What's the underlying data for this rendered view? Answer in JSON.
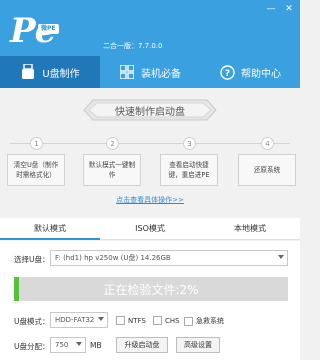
{
  "window": {
    "logo_text": "Pe",
    "logo_badge": "微PE",
    "version": "二合一版：7.7.0.0",
    "minimize_glyph": "—",
    "close_glyph": "✕"
  },
  "nav_tabs": [
    {
      "label": "U盘制作",
      "icon": "usb-drive-icon",
      "active": true
    },
    {
      "label": "装机必备",
      "icon": "apps-grid-icon",
      "active": false
    },
    {
      "label": "帮助中心",
      "icon": "help-circle-icon",
      "active": false
    }
  ],
  "banner": {
    "title": "快速制作启动盘"
  },
  "steps": [
    {
      "num": "1",
      "text": "清空U盘（制作时需格式化）"
    },
    {
      "num": "2",
      "text": "默认模式一键制作"
    },
    {
      "num": "3",
      "text": "查看启动快捷键，重启进PE"
    },
    {
      "num": "4",
      "text": "还原系统"
    }
  ],
  "steps_link": "点击查看具体操作>>",
  "mode_tabs": [
    {
      "label": "默认模式",
      "active": true
    },
    {
      "label": "ISO模式",
      "active": false
    },
    {
      "label": "本地模式",
      "active": false
    }
  ],
  "form": {
    "select_usb_label": "选择U盘：",
    "select_usb_value": "F: (hd1) hp v250w  (U盘) 14.26GB",
    "progress_text": "正在检验文件:2%",
    "progress_value": 0.02,
    "usb_mode_label": "U盘模式：",
    "usb_mode_value": "HDD-FAT32",
    "ntfs_label": "NTFS",
    "chs_label": "CHS",
    "hidden_sys_label": "急救系统",
    "usb_alloc_label": "U盘分配：",
    "usb_alloc_value": "750",
    "usb_alloc_unit": "MB",
    "upgrade_button": "升级启动盘",
    "advanced_button": "高级设置"
  },
  "colors": {
    "header_blue": "#3aa0e0",
    "active_tab_blue": "#2178b8",
    "progress_green": "#55c13b",
    "link_blue": "#2a8bd5"
  }
}
